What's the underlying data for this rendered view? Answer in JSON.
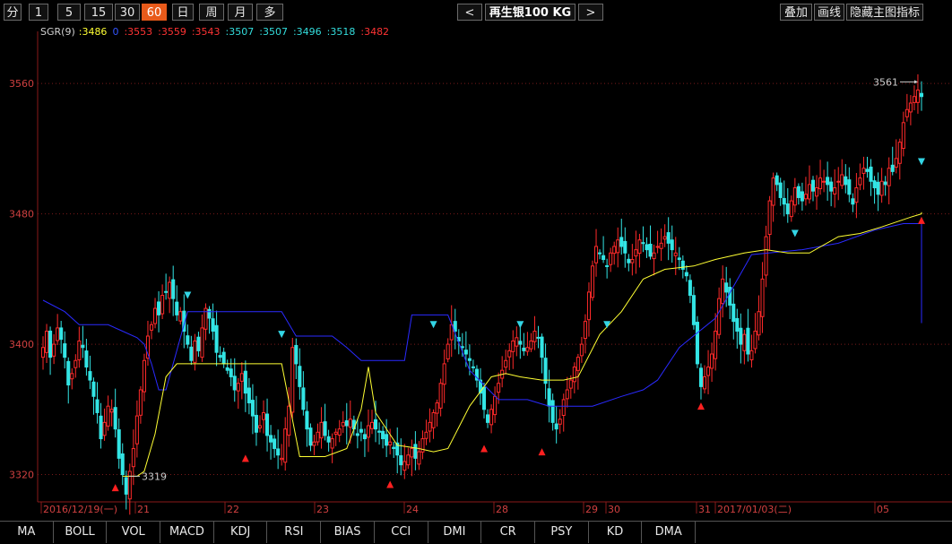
{
  "periods": [
    "分",
    "1",
    "5",
    "15",
    "30",
    "60",
    "日",
    "周",
    "月",
    "多"
  ],
  "active_period": "60",
  "nav": {
    "prev": "<",
    "next": ">",
    "symbol": "再生银100 KG"
  },
  "tools": [
    "叠加",
    "画线",
    "隐藏主图指标"
  ],
  "indicator": {
    "name": "SGR(9)",
    "values": [
      {
        "text": ":3486",
        "color": "#ffff33"
      },
      {
        "text": "0",
        "color": "#3355ff"
      },
      {
        "text": ":3553",
        "color": "#ff3333"
      },
      {
        "text": ":3559",
        "color": "#ff3333"
      },
      {
        "text": ":3543",
        "color": "#ff3333"
      },
      {
        "text": ":3507",
        "color": "#33dddd"
      },
      {
        "text": ":3507",
        "color": "#33dddd"
      },
      {
        "text": ":3496",
        "color": "#33dddd"
      },
      {
        "text": ":3518",
        "color": "#33dddd"
      },
      {
        "text": ":3482",
        "color": "#ff3333"
      }
    ]
  },
  "colors": {
    "up": "#ff2a2a",
    "down": "#33e5e5",
    "support": "#ffff33",
    "resistance": "#2a2aff",
    "grid": "#7a1a1a",
    "axis": "#8a1a1a",
    "tick_text": "#d04040",
    "date_text": "#d04040"
  },
  "chart_data": {
    "type": "candlestick",
    "y_ticks": [
      3320,
      3400,
      3480,
      3560
    ],
    "ylim": [
      3306,
      3592
    ],
    "x_labels": [
      "2016/12/19(一)",
      "21",
      "22",
      "23",
      "24",
      "28",
      "29",
      "30",
      "31",
      "2017/01/03(二)",
      "05"
    ],
    "annotations": [
      {
        "text": "3561",
        "price": 3561
      },
      {
        "text": "3319",
        "price": 3319
      }
    ],
    "closes": [
      3398,
      3408,
      3392,
      3400,
      3410,
      3403,
      3392,
      3375,
      3382,
      3390,
      3402,
      3398,
      3386,
      3378,
      3368,
      3358,
      3342,
      3352,
      3362,
      3360,
      3348,
      3330,
      3320,
      3308,
      3322,
      3336,
      3356,
      3372,
      3390,
      3405,
      3412,
      3422,
      3418,
      3430,
      3432,
      3438,
      3428,
      3418,
      3420,
      3408,
      3400,
      3390,
      3402,
      3396,
      3410,
      3422,
      3416,
      3408,
      3395,
      3392,
      3388,
      3384,
      3380,
      3372,
      3376,
      3382,
      3370,
      3364,
      3356,
      3346,
      3350,
      3358,
      3344,
      3340,
      3336,
      3332,
      3330,
      3348,
      3362,
      3398,
      3388,
      3374,
      3360,
      3348,
      3338,
      3340,
      3346,
      3352,
      3344,
      3340,
      3342,
      3346,
      3348,
      3352,
      3350,
      3354,
      3348,
      3344,
      3346,
      3342,
      3350,
      3352,
      3348,
      3346,
      3342,
      3338,
      3340,
      3336,
      3332,
      3326,
      3328,
      3332,
      3336,
      3330,
      3334,
      3342,
      3346,
      3352,
      3358,
      3364,
      3376,
      3388,
      3400,
      3412,
      3408,
      3402,
      3398,
      3394,
      3390,
      3386,
      3378,
      3370,
      3360,
      3352,
      3360,
      3368,
      3376,
      3384,
      3390,
      3396,
      3402,
      3404,
      3400,
      3396,
      3398,
      3402,
      3408,
      3404,
      3392,
      3376,
      3362,
      3352,
      3348,
      3354,
      3366,
      3372,
      3378,
      3386,
      3392,
      3400,
      3414,
      3432,
      3448,
      3460,
      3456,
      3452,
      3448,
      3456,
      3460,
      3464,
      3460,
      3456,
      3450,
      3452,
      3458,
      3464,
      3462,
      3458,
      3454,
      3456,
      3460,
      3462,
      3466,
      3462,
      3458,
      3456,
      3452,
      3446,
      3442,
      3430,
      3412,
      3388,
      3374,
      3380,
      3386,
      3394,
      3408,
      3428,
      3440,
      3432,
      3424,
      3414,
      3408,
      3400,
      3406,
      3394,
      3396,
      3408,
      3420,
      3440,
      3466,
      3488,
      3502,
      3498,
      3490,
      3486,
      3480,
      3488,
      3496,
      3490,
      3488,
      3492,
      3498,
      3494,
      3496,
      3502,
      3500,
      3498,
      3494,
      3496,
      3500,
      3504,
      3498,
      3492,
      3486,
      3496,
      3502,
      3508,
      3506,
      3500,
      3496,
      3492,
      3500,
      3498,
      3508,
      3506,
      3514,
      3524,
      3536,
      3544,
      3548,
      3552,
      3556,
      3552
    ]
  }
}
